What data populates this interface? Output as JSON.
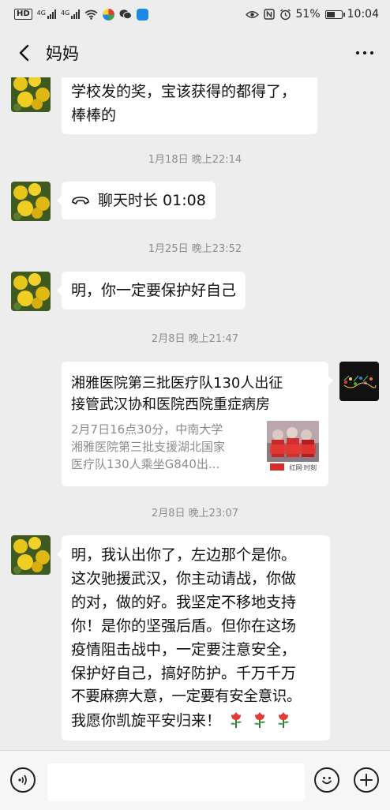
{
  "status_bar": {
    "hd_label": "HD",
    "network_1": "4G",
    "network_2": "4G",
    "battery_percent": "51%",
    "time": "10:04",
    "icons": [
      "wifi-icon",
      "app-icon-browser",
      "wechat-icon",
      "app-icon-blue",
      "eye-icon",
      "nfc-icon",
      "alarm-icon",
      "battery-icon"
    ],
    "battery_level": 0.51
  },
  "header": {
    "title": "妈妈",
    "icons": [
      "back-icon",
      "more-icon"
    ]
  },
  "messages": [
    {
      "sender": "mom",
      "line1": "学校发的奖，宝该获得的都得了，",
      "line2": "棒棒的"
    },
    {
      "type": "timestamp",
      "text": "1月18日 晚上22:14"
    },
    {
      "sender": "mom",
      "type": "call",
      "icon": "phone-hangup-icon",
      "text": "聊天时长 01:08"
    },
    {
      "type": "timestamp",
      "text": "1月25日 晚上23:52"
    },
    {
      "sender": "mom",
      "text": "明，你一定要保护好自己"
    },
    {
      "type": "timestamp",
      "text": "2月8日 晚上21:47"
    },
    {
      "sender": "me",
      "type": "link-card",
      "title_line1": "湘雅医院第三批医疗队130人出征",
      "title_line2": "接管武汉协和医院西院重症病房",
      "desc_line1": "2月7日16点30分，中南大学",
      "desc_line2": "湘雅医院第三批支援湖北国家",
      "desc_line3": "医疗队130人乘坐G840出...",
      "thumb_caption": "红网·时刻"
    },
    {
      "type": "timestamp",
      "text": "2月8日 晚上23:07"
    },
    {
      "sender": "mom",
      "lines": [
        "明，我认出你了，左边那个是你。",
        "这次驰援武汉，你主动请战，你做",
        "的对，做的好。我坚定不移地支持",
        "你！是你的坚强后盾。但你在这场",
        "疫情阻击战中，一定要注意安全，",
        "保护好自己，搞好防护。千万千万",
        "不要麻痹大意，一定要有安全意识。",
        "我愿你凯旋平安归来！"
      ],
      "emoji": [
        "rose-icon",
        "rose-icon",
        "rose-icon"
      ]
    }
  ],
  "input_bar": {
    "placeholder": "",
    "icons": [
      "voice-icon",
      "emoji-icon",
      "plus-icon"
    ]
  },
  "colors": {
    "background": "#ededed",
    "bubble": "#ffffff",
    "timestamp": "#8d8d8d",
    "input_bar": "#f6f6f6"
  }
}
